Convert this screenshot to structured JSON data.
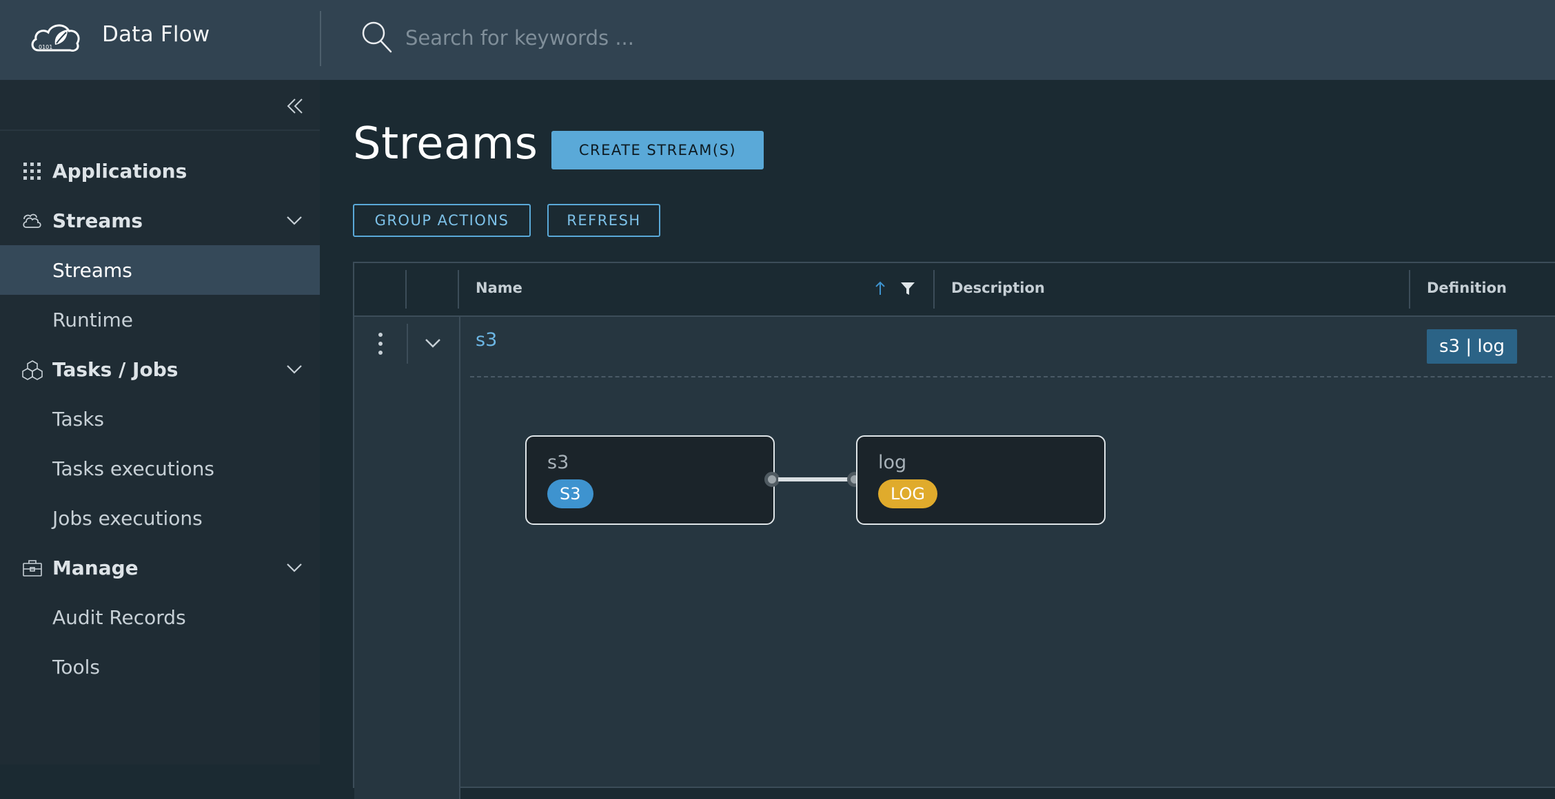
{
  "header": {
    "app_title": "Data Flow",
    "search_placeholder": "Search for keywords ..."
  },
  "sidebar": {
    "groups": [
      {
        "label": "Applications",
        "icon": "apps-grid-icon"
      },
      {
        "label": "Streams",
        "icon": "clouds-icon",
        "items": [
          "Streams",
          "Runtime"
        ]
      },
      {
        "label": "Tasks / Jobs",
        "icon": "cubes-icon",
        "items": [
          "Tasks",
          "Tasks executions",
          "Jobs executions"
        ]
      },
      {
        "label": "Manage",
        "icon": "briefcase-icon",
        "items": [
          "Audit Records",
          "Tools"
        ]
      }
    ],
    "active_item": "Streams"
  },
  "main": {
    "title": "Streams",
    "create_button": "CREATE STREAM(S)",
    "group_actions_button": "GROUP ACTIONS",
    "refresh_button": "REFRESH",
    "columns": [
      "Name",
      "Description",
      "Definition"
    ],
    "rows": [
      {
        "name": "s3",
        "description": "",
        "definition": "s3 | log",
        "graph": {
          "nodes": [
            {
              "title": "s3",
              "badge": "S3",
              "badge_color": "#3e93cf"
            },
            {
              "title": "log",
              "badge": "LOG",
              "badge_color": "#e0ab2c"
            }
          ]
        }
      }
    ]
  },
  "colors": {
    "header_bg": "#314351",
    "sidebar_bg": "#1f2c34",
    "active_bg": "#354959",
    "accent": "#5aa9d8",
    "link": "#6cb6e4"
  }
}
